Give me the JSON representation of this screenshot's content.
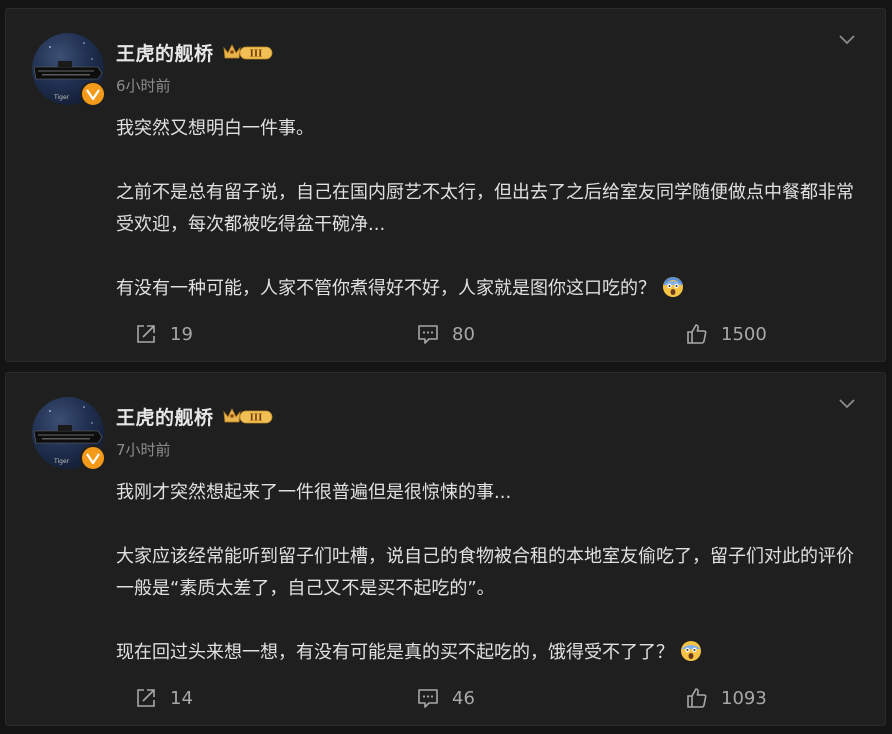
{
  "feed": {
    "posts": [
      {
        "author": "王虎的舰桥",
        "time": "6小时前",
        "paragraphs": [
          "我突然又想明白一件事。",
          "之前不是总有留子说，自己在国内厨艺不太行，但出去了之后给室友同学随便做点中餐都非常受欢迎，每次都被吃得盆干碗净...",
          "有没有一种可能，人家不管你煮得好不好，人家就是图你这口吃的？"
        ],
        "shares": "19",
        "comments": "80",
        "likes": "1500"
      },
      {
        "author": "王虎的舰桥",
        "time": "7小时前",
        "paragraphs": [
          "我刚才突然想起来了一件很普遍但是很惊悚的事...",
          "大家应该经常能听到留子们吐槽，说自己的食物被合租的本地室友偷吃了，留子们对此的评价一般是“素质太差了，自己又不是买不起吃的”。",
          "现在回过头来想一想，有没有可能是真的买不起吃的，饿得受不了了？"
        ],
        "shares": "14",
        "comments": "46",
        "likes": "1093"
      }
    ]
  },
  "badge": {
    "level_text": "III",
    "avatar_text": "Tiger"
  },
  "icons": {
    "verify": "verified-v-icon",
    "level": "crown-level-icon",
    "emoji": "scared-face-emoji",
    "share": "share-icon",
    "comment": "comment-icon",
    "like": "thumbs-up-icon",
    "menu": "chevron-down-icon"
  },
  "colors": {
    "background": "#141414",
    "card": "#1f1f1f",
    "text": "#e0e0e0",
    "muted": "#8c8c8c",
    "verify": "#f39a1b",
    "level_gold": "#e7b34a"
  }
}
